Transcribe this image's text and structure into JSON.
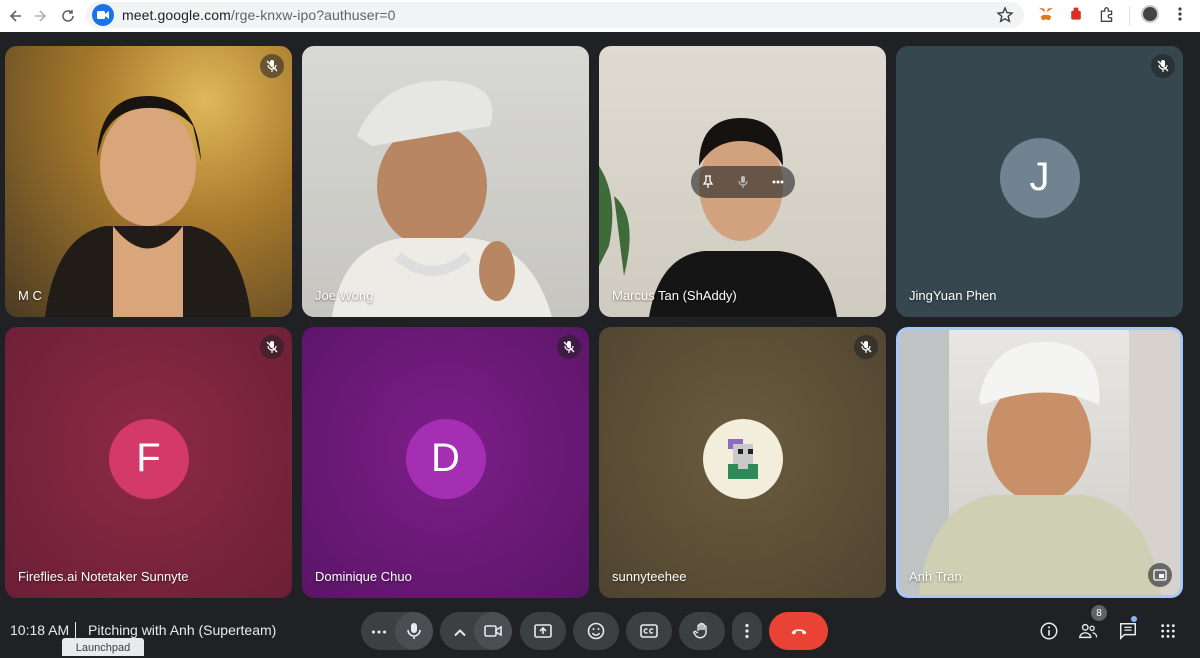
{
  "browser": {
    "url_host": "meet.google.com",
    "url_path": "/rge-knxw-ipo?authuser=0"
  },
  "participants": [
    {
      "name": "M C",
      "muted": true,
      "kind": "video"
    },
    {
      "name": "Joe Wong",
      "muted": false,
      "kind": "video"
    },
    {
      "name": "Marcus Tan (ShAddy)",
      "muted": false,
      "kind": "video"
    },
    {
      "name": "JingYuan Phen",
      "muted": true,
      "kind": "initial",
      "initial": "J",
      "color": "#6f8390"
    },
    {
      "name": "Fireflies.ai Notetaker Sunnyte",
      "muted": true,
      "kind": "initial",
      "initial": "F",
      "color": "#d33a6a"
    },
    {
      "name": "Dominique Chuo",
      "muted": true,
      "kind": "initial",
      "initial": "D",
      "color": "#a42fb3"
    },
    {
      "name": "sunnyteehee",
      "muted": true,
      "kind": "image"
    },
    {
      "name": "Anh Tran",
      "muted": false,
      "kind": "video"
    }
  ],
  "meeting": {
    "time": "10:18 AM",
    "title": "Pitching with Anh (Superteam)",
    "people_count": "8"
  },
  "tooltip": "Launchpad",
  "colors": {
    "end_call": "#ea4335",
    "background": "#202124",
    "control": "#3c4043",
    "active_border": "#a8c7fa"
  },
  "icons": [
    "back-icon",
    "forward-icon",
    "reload-icon",
    "meet-icon",
    "star-icon",
    "metamask-icon",
    "extension-icon",
    "puzzle-icon",
    "profile-icon",
    "menu-icon",
    "mic-off-icon",
    "pin-icon",
    "more-icon",
    "mic-icon",
    "chevron-up-icon",
    "camera-icon",
    "present-icon",
    "emoji-icon",
    "captions-icon",
    "raise-hand-icon",
    "end-call-icon",
    "info-icon",
    "people-icon",
    "chat-icon",
    "apps-icon",
    "pip-icon"
  ]
}
